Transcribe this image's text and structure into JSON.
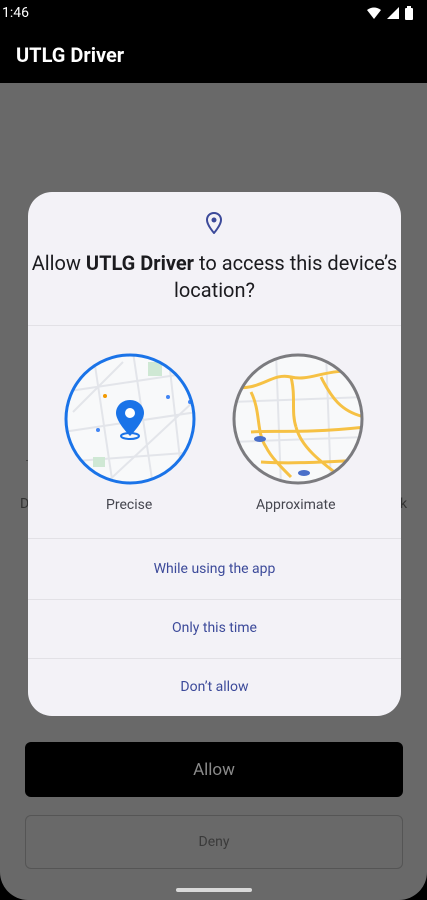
{
  "status_bar": {
    "time": "1:46"
  },
  "app_bar": {
    "title": "UTLG Driver"
  },
  "background": {
    "left_fragment": "D",
    "right_fragment": "k"
  },
  "dialog": {
    "heading_prefix": "Allow ",
    "heading_app": "UTLG Driver",
    "heading_suffix": " to access this device’s location?",
    "options": [
      {
        "label": "Precise",
        "selected": true
      },
      {
        "label": "Approximate",
        "selected": false
      }
    ],
    "actions": [
      {
        "label": "While using the app"
      },
      {
        "label": "Only this time"
      },
      {
        "label": "Don’t allow"
      }
    ]
  },
  "buttons": {
    "allow": "Allow",
    "deny": "Deny"
  },
  "colors": {
    "accent_blue": "#1a73e8",
    "action_text": "#3c4a9a",
    "dialog_bg": "#f3f2f7"
  }
}
